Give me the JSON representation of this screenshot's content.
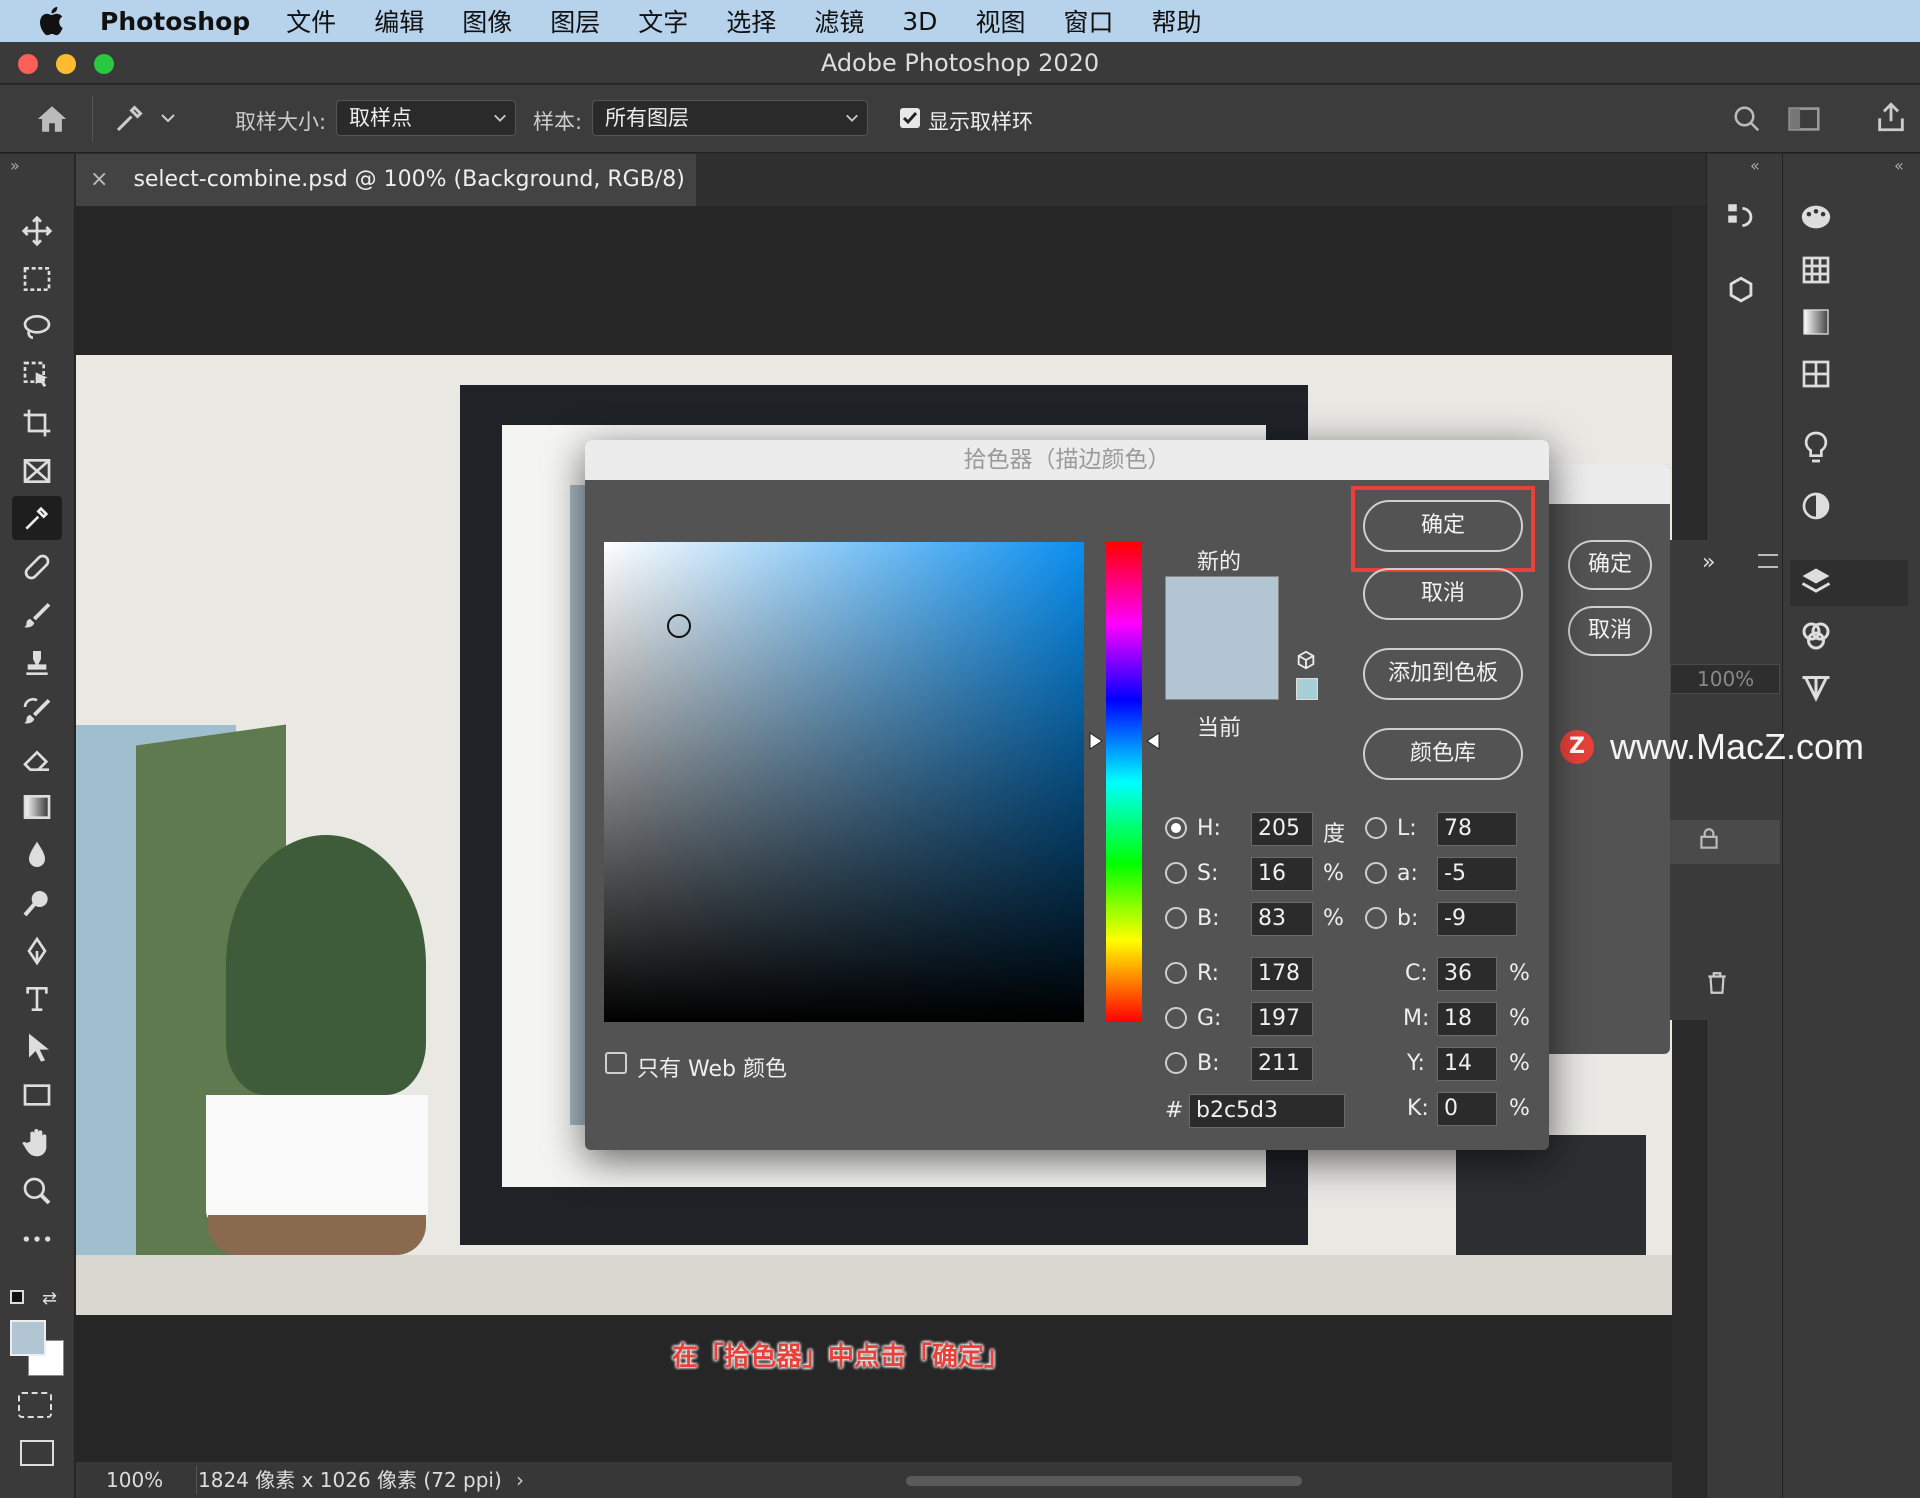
{
  "menubar": {
    "app_name": "Photoshop",
    "items": [
      "文件",
      "编辑",
      "图像",
      "图层",
      "文字",
      "选择",
      "滤镜",
      "3D",
      "视图",
      "窗口",
      "帮助"
    ]
  },
  "window": {
    "title": "Adobe Photoshop 2020"
  },
  "options_bar": {
    "sample_size_label": "取样大小:",
    "sample_size_value": "取样点",
    "sample_label": "样本:",
    "sample_value": "所有图层",
    "show_ring_label": "显示取样环",
    "show_ring_checked": true
  },
  "document_tab": {
    "title": "select-combine.psd @ 100% (Background, RGB/8) *"
  },
  "status_bar": {
    "zoom": "100%",
    "info": "1824 像素 x 1026 像素 (72 ppi)"
  },
  "color_picker": {
    "title": "拾色器（描边颜色）",
    "ok_label": "确定",
    "cancel_label": "取消",
    "add_swatch_label": "添加到色板",
    "color_libraries_label": "颜色库",
    "new_label": "新的",
    "current_label": "当前",
    "web_only_label": "只有 Web 颜色",
    "new_color": "#b2c5d3",
    "current_color": "#b2c5d3",
    "hue_base_color": "#0a8ff0",
    "hsb": {
      "h_label": "H:",
      "h": "205",
      "h_unit": "度",
      "s_label": "S:",
      "s": "16",
      "s_unit": "%",
      "b_label": "B:",
      "b": "83",
      "b_unit": "%"
    },
    "lab": {
      "l_label": "L:",
      "l": "78",
      "a_label": "a:",
      "a": "-5",
      "b_label": "b:",
      "b": "-9"
    },
    "rgb": {
      "r_label": "R:",
      "r": "178",
      "g_label": "G:",
      "g": "197",
      "b_label": "B:",
      "b": "211"
    },
    "cmyk": {
      "c_label": "C:",
      "c": "36",
      "m_label": "M:",
      "m": "18",
      "y_label": "Y:",
      "y": "14",
      "k_label": "K:",
      "k": "0",
      "unit": "%"
    },
    "hex_label": "#",
    "hex": "b2c5d3"
  },
  "background_dialog": {
    "ok_label": "确定",
    "cancel_label": "取消"
  },
  "layers_panel": {
    "opacity": "100%"
  },
  "watermark": {
    "text": "www.MacZ.com"
  },
  "caption": {
    "text": "在「拾色器」中点击「确定」"
  },
  "colors": {
    "highlight_box": "#e8413a",
    "menubar_bg": "#b7d3ec"
  }
}
